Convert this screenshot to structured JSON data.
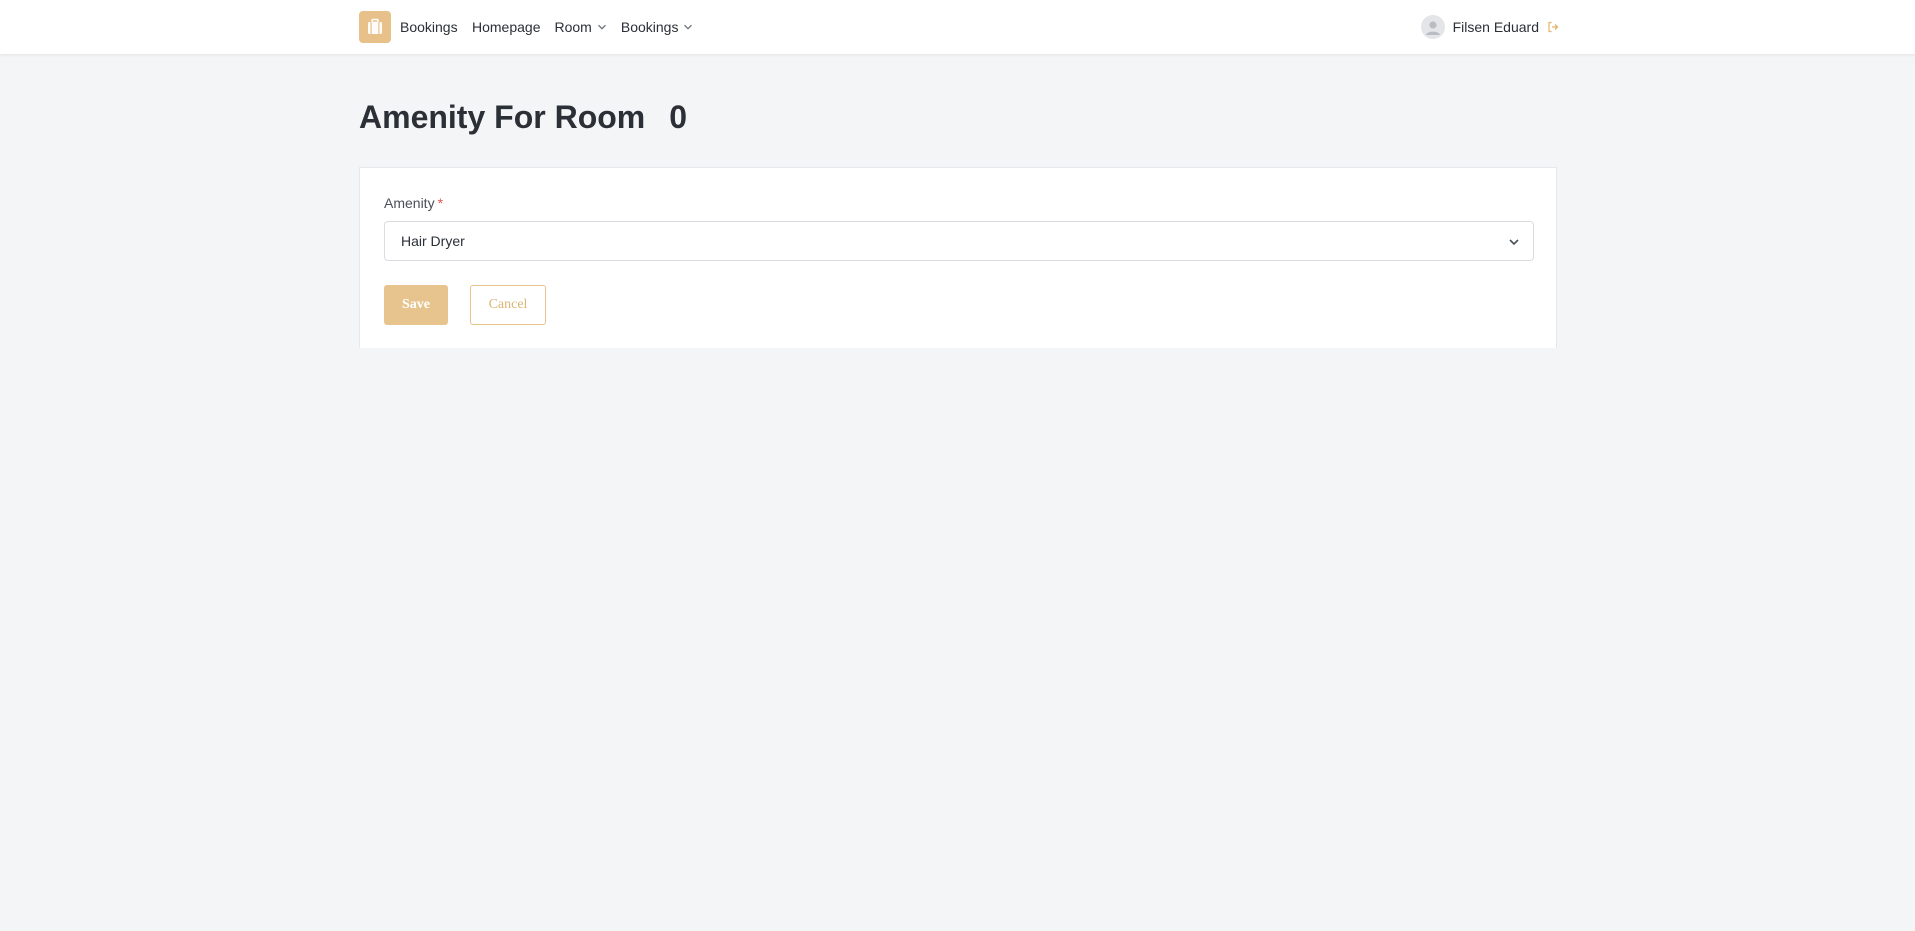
{
  "colors": {
    "accent": "#e7c48e",
    "page_background": "#f3f5f7",
    "required_marker": "#e0554a"
  },
  "nav": {
    "brand": {
      "icon": "briefcase-icon",
      "label": "Bookings"
    },
    "links": [
      {
        "label": "Homepage",
        "has_dropdown": false
      },
      {
        "label": "Room",
        "has_dropdown": true,
        "icon": "chevron-down-icon"
      },
      {
        "label": "Bookings",
        "has_dropdown": true,
        "icon": "chevron-down-icon"
      }
    ],
    "user": {
      "avatar_icon": "user-avatar-icon",
      "name": "Filsen Eduard",
      "logout_icon": "sign-out-icon"
    }
  },
  "page": {
    "title": "Amenity For Room",
    "title_number": "0"
  },
  "form": {
    "amenity_label": "Amenity",
    "required_marker": "*",
    "amenity_value": "Hair Dryer",
    "save_label": "Save",
    "cancel_label": "Cancel"
  }
}
